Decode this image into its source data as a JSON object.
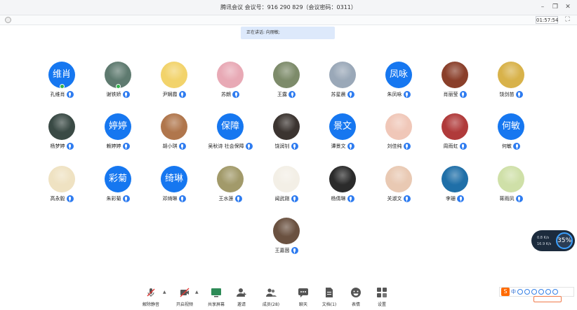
{
  "window": {
    "title": "腾讯会议 会议号：916 290 829（会议密码：0311）",
    "meeting_time": "01:57:54"
  },
  "speaking": {
    "label": "正在讲话: 向丽敏;"
  },
  "participants": [
    {
      "name": "孔维肖",
      "avatar_text": "维肖",
      "avatar_color": "#1677f0"
    },
    {
      "name": "谢铁娇",
      "avatar_text": "",
      "avatar_color": "#5e7a6f"
    },
    {
      "name": "尹娴霞",
      "avatar_text": "",
      "avatar_color": "#f2d36b"
    },
    {
      "name": "苏朗",
      "avatar_text": "",
      "avatar_color": "#e8a9b5"
    },
    {
      "name": "王露",
      "avatar_text": "",
      "avatar_color": "#7d8b6a"
    },
    {
      "name": "苏星晨",
      "avatar_text": "",
      "avatar_color": "#9aa8b8"
    },
    {
      "name": "朱凤咏",
      "avatar_text": "凤咏",
      "avatar_color": "#1677f0"
    },
    {
      "name": "肖丽莹",
      "avatar_text": "",
      "avatar_color": "#8a3f2a"
    },
    {
      "name": "饶剑苗",
      "avatar_text": "",
      "avatar_color": "#d8b24a"
    },
    {
      "name": "杨梦婷",
      "avatar_text": "",
      "avatar_color": "#3a4a45"
    },
    {
      "name": "赖婷婷",
      "avatar_text": "婷婷",
      "avatar_color": "#1677f0"
    },
    {
      "name": "胡小琪",
      "avatar_text": "",
      "avatar_color": "#b0764c"
    },
    {
      "name": "吴秋诗 社会保障",
      "avatar_text": "保障",
      "avatar_color": "#1677f0"
    },
    {
      "name": "饶润钊",
      "avatar_text": "",
      "avatar_color": "#3b3430"
    },
    {
      "name": "谭景文",
      "avatar_text": "景文",
      "avatar_color": "#1677f0"
    },
    {
      "name": "刘佳纯",
      "avatar_text": "",
      "avatar_color": "#f0c7b8"
    },
    {
      "name": "周雨虹",
      "avatar_text": "",
      "avatar_color": "#b03a3a"
    },
    {
      "name": "何敏",
      "avatar_text": "何敏",
      "avatar_color": "#1677f0"
    },
    {
      "name": "高永毅",
      "avatar_text": "",
      "avatar_color": "#efe2c2"
    },
    {
      "name": "朱彩菊",
      "avatar_text": "彩菊",
      "avatar_color": "#1677f0"
    },
    {
      "name": "邓绮琳",
      "avatar_text": "绮琳",
      "avatar_color": "#1677f0"
    },
    {
      "name": "王水莲",
      "avatar_text": "",
      "avatar_color": "#a29a6a"
    },
    {
      "name": "闻武刚",
      "avatar_text": "",
      "avatar_color": "#f3efe6"
    },
    {
      "name": "杨倩琳",
      "avatar_text": "",
      "avatar_color": "#2b2b2b"
    },
    {
      "name": "关淑文",
      "avatar_text": "",
      "avatar_color": "#e9c9b3"
    },
    {
      "name": "李珊",
      "avatar_text": "",
      "avatar_color": "#1f6fa8"
    },
    {
      "name": "蒋雨凤",
      "avatar_text": "",
      "avatar_color": "#cfe0a8"
    },
    {
      "name": "王嘉茵",
      "avatar_text": "",
      "avatar_color": "#6a5140"
    }
  ],
  "toolbar": {
    "unmute": "解除静音",
    "video": "开启视频",
    "share": "共享屏幕",
    "invite": "邀请",
    "members": "成员(28)",
    "chat": "聊天",
    "docs": "文档(1)",
    "emoji": "表情",
    "settings": "设置"
  },
  "network_widget": {
    "upload": "0.8 K/s",
    "download": "16.9 K/s",
    "percent": "35%"
  },
  "ime": {
    "mode": "中"
  }
}
